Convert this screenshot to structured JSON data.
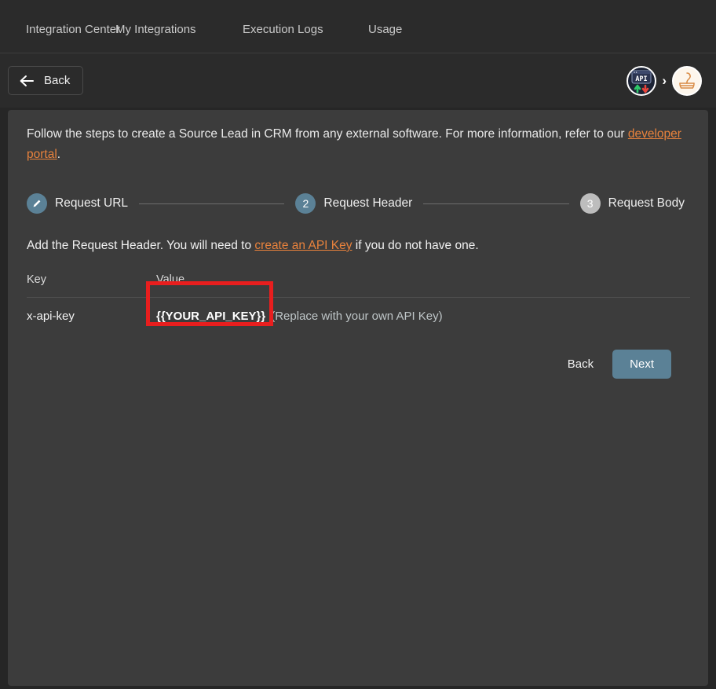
{
  "nav": {
    "tabs": [
      {
        "label": "Integration Center"
      },
      {
        "label": "My Integrations"
      },
      {
        "label": "Execution Logs"
      },
      {
        "label": "Usage"
      }
    ]
  },
  "header": {
    "back_label": "Back",
    "back_icon": "arrow-left-icon",
    "breadcrumb": {
      "separator": "›",
      "api_avatar_label": "API",
      "app_avatar_label": "snake-logo"
    }
  },
  "content": {
    "intro_part1": "Follow the steps to create a Source Lead in CRM from any external software. For more information, refer to our ",
    "intro_link": "developer portal",
    "intro_part2": ".",
    "steps": [
      {
        "marker": "✎",
        "label": "Request URL",
        "state": "done"
      },
      {
        "marker": "2",
        "label": "Request Header",
        "state": "active"
      },
      {
        "marker": "3",
        "label": "Request Body",
        "state": "todo"
      }
    ],
    "instruction_part1": "Add the Request Header. You will need to ",
    "instruction_link": "create an API Key",
    "instruction_part2": " if you do not have one.",
    "table": {
      "columns": [
        "Key",
        "Value"
      ],
      "rows": [
        {
          "key": "x-api-key",
          "value_token": "{{YOUR_API_KEY}}",
          "value_note": "(Replace with your own API Key)"
        }
      ]
    },
    "actions": {
      "back_label": "Back",
      "next_label": "Next"
    }
  },
  "annotation": {
    "highlight_target": "{{YOUR_API_KEY}}",
    "highlight_color": "#e81e1e"
  },
  "colors": {
    "page_background": "#262626",
    "panel_background": "#3c3c3c",
    "nav_background": "#2b2b2b",
    "accent_link": "#e8823c",
    "step_active": "#5b8196",
    "step_todo": "#bdbdbd",
    "primary_button": "#5b8196"
  }
}
